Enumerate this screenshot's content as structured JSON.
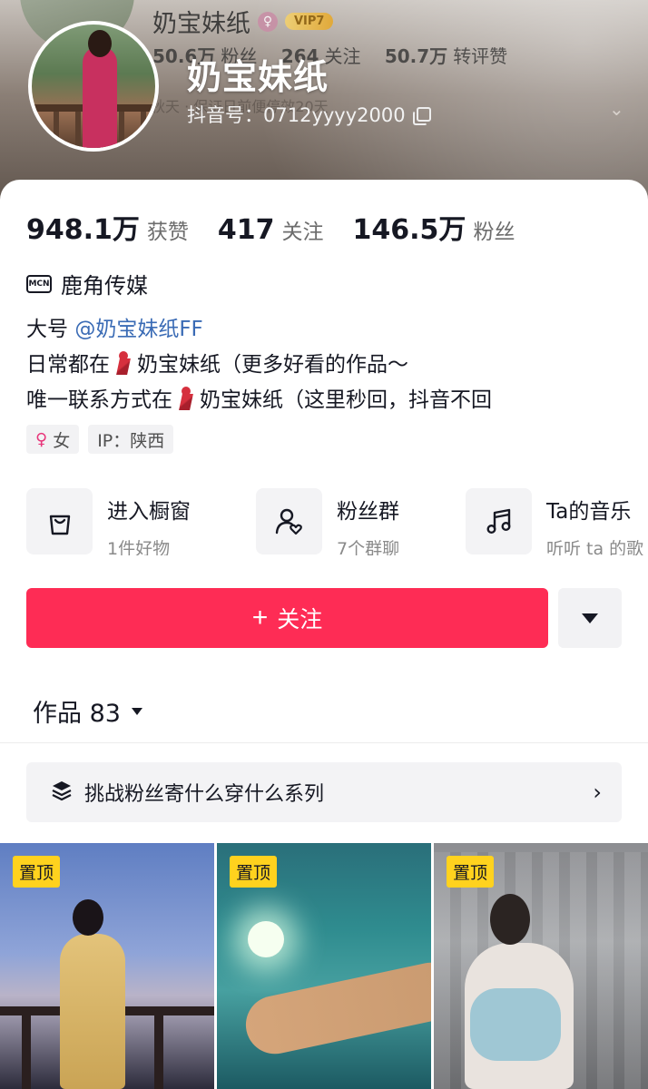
{
  "header": {
    "ghost_name": "奶宝妹纸",
    "ghost_vip": "VIP7",
    "ghost_stats": [
      {
        "value": "50.6万",
        "label": "粉丝"
      },
      {
        "value": "264",
        "label": "关注"
      },
      {
        "value": "50.7万",
        "label": "转评赞"
      }
    ],
    "ghost_strip": "掘秋天 · 保证日前便停效20天",
    "nickname": "奶宝妹纸",
    "douyin_id": "抖音号：0712yyyy2000"
  },
  "stats": [
    {
      "value": "948.1万",
      "label": "获赞"
    },
    {
      "value": "417",
      "label": "关注"
    },
    {
      "value": "146.5万",
      "label": "粉丝"
    }
  ],
  "mcn": {
    "icon_text": "MCN",
    "name": "鹿角传媒"
  },
  "bio": {
    "line1_prefix": "大号 ",
    "line1_mention": "@奶宝妹纸FF",
    "line2_prefix": "日常都在",
    "line2_suffix": "奶宝妹纸（更多好看的作品～",
    "line3_prefix": "唯一联系方式在",
    "line3_suffix": "奶宝妹纸（这里秒回，抖音不回"
  },
  "tags": {
    "gender": "女",
    "ip": "IP：陕西"
  },
  "features": [
    {
      "icon": "shopping-bag-icon",
      "title": "进入橱窗",
      "sub": "1件好物"
    },
    {
      "icon": "fan-group-icon",
      "title": "粉丝群",
      "sub": "7个群聊"
    },
    {
      "icon": "music-note-icon",
      "title": "Ta的音乐",
      "sub": "听听 ta 的歌"
    }
  ],
  "follow_label": "关注",
  "works_tab": "作品 83",
  "collection": "挑战粉丝寄什么穿什么系列",
  "grid": [
    {
      "pin": "置顶"
    },
    {
      "pin": "置顶"
    },
    {
      "pin": "置顶"
    }
  ],
  "colors": {
    "accent": "#fe2c55",
    "mention": "#3a6bb5",
    "pin": "#ffd21e"
  }
}
